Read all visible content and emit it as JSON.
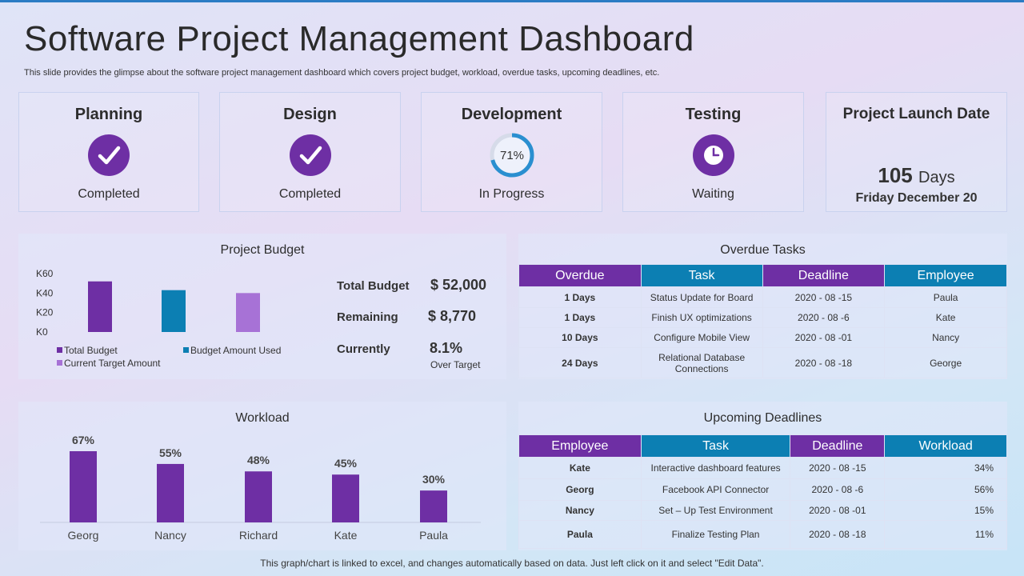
{
  "header": {
    "title": "Software Project Management Dashboard",
    "subtitle": "This slide provides the glimpse about the software project management dashboard which covers project budget, workload, overdue tasks, upcoming deadlines, etc."
  },
  "stages": [
    {
      "name": "Planning",
      "status": "Completed",
      "icon": "checkmark-icon"
    },
    {
      "name": "Design",
      "status": "Completed",
      "icon": "checkmark-icon"
    },
    {
      "name": "Development",
      "status": "In Progress",
      "icon": "progress-ring-icon",
      "progress_label": "71%",
      "progress": 0.71
    },
    {
      "name": "Testing",
      "status": "Waiting",
      "icon": "clock-icon"
    }
  ],
  "launch": {
    "title": "Project Launch Date",
    "days": "105",
    "days_unit": "Days",
    "date": "Friday December 20"
  },
  "budget": {
    "title": "Project Budget",
    "rows": [
      {
        "label": "Total Budget",
        "value": "$ 52,000",
        "note": ""
      },
      {
        "label": "Remaining",
        "value": "$ 8,770",
        "note": ""
      },
      {
        "label": "Currently",
        "value": "8.1%",
        "note": "Over Target"
      }
    ]
  },
  "overdue": {
    "title": "Overdue Tasks",
    "headers": [
      "Overdue",
      "Task",
      "Deadline",
      "Employee"
    ],
    "rows": [
      [
        "1 Days",
        "Status Update for Board",
        "2020 - 08 -15",
        "Paula"
      ],
      [
        "1 Days",
        "Finish UX optimizations",
        "2020 - 08 -6",
        "Kate"
      ],
      [
        "10 Days",
        "Configure Mobile View",
        "2020 - 08 -01",
        "Nancy"
      ],
      [
        "24 Days",
        "Relational Database Connections",
        "2020 - 08 -18",
        "George"
      ]
    ]
  },
  "upcoming": {
    "title": "Upcoming Deadlines",
    "headers": [
      "Employee",
      "Task",
      "Deadline",
      "Workload"
    ],
    "rows": [
      [
        "Kate",
        "Interactive dashboard features",
        "2020 - 08 -15",
        "34%"
      ],
      [
        "Georg",
        "Facebook API Connector",
        "2020 - 08 -6",
        "56%"
      ],
      [
        "Nancy",
        "Set – Up Test Environment",
        "2020 - 08 -01",
        "15%"
      ],
      [
        "Paula",
        "Finalize Testing Plan",
        "2020 - 08 -18",
        "11%"
      ]
    ]
  },
  "footer": "This graph/chart is linked to excel, and changes automatically based on data. Just left click on it and select \"Edit Data\".",
  "colors": {
    "purple": "#6e2fa4",
    "teal": "#0c7fb3",
    "lilac": "#a772d6",
    "ring": "#2a8fd0"
  },
  "chart_data": [
    {
      "type": "bar",
      "title": "Project Budget",
      "categories": [
        "Total Budget",
        "Budget Amount Used",
        "Current Target Amount"
      ],
      "values": [
        52,
        43,
        40
      ],
      "ytick_labels": [
        "K0",
        "K20",
        "K40",
        "K60"
      ],
      "ylim": [
        0,
        60
      ],
      "legend": [
        "Total Budget",
        "Budget Amount Used",
        "Current Target Amount"
      ],
      "legend_placement": "bottom"
    },
    {
      "type": "bar",
      "title": "Workload",
      "categories": [
        "Georg",
        "Nancy",
        "Richard",
        "Kate",
        "Paula"
      ],
      "values": [
        67,
        55,
        48,
        45,
        30
      ],
      "data_labels": [
        "67%",
        "55%",
        "48%",
        "45%",
        "30%"
      ],
      "ylim": [
        0,
        70
      ]
    }
  ]
}
